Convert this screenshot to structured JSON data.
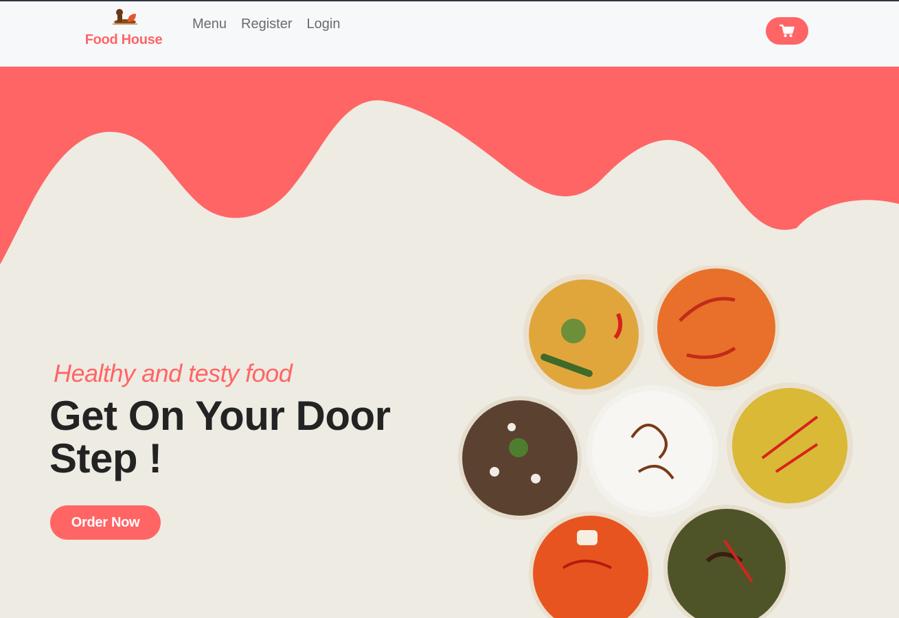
{
  "brand": {
    "name": "Food House",
    "logo_icon": "chef-logo-icon"
  },
  "nav": {
    "items": [
      {
        "label": "Menu"
      },
      {
        "label": "Register"
      },
      {
        "label": "Login"
      }
    ],
    "cart_icon": "shopping-cart-icon"
  },
  "hero": {
    "tagline": "Healthy and testy food",
    "headline_line1": "Get On Your Door",
    "headline_line2": "Step !",
    "cta_label": "Order Now",
    "image_name": "indian-dishes-bowls"
  },
  "colors": {
    "accent": "#ff6565",
    "background": "#eeebe3",
    "navbar": "#f7f8fa",
    "headline": "#232323",
    "nav_text": "#6b6b6b"
  }
}
